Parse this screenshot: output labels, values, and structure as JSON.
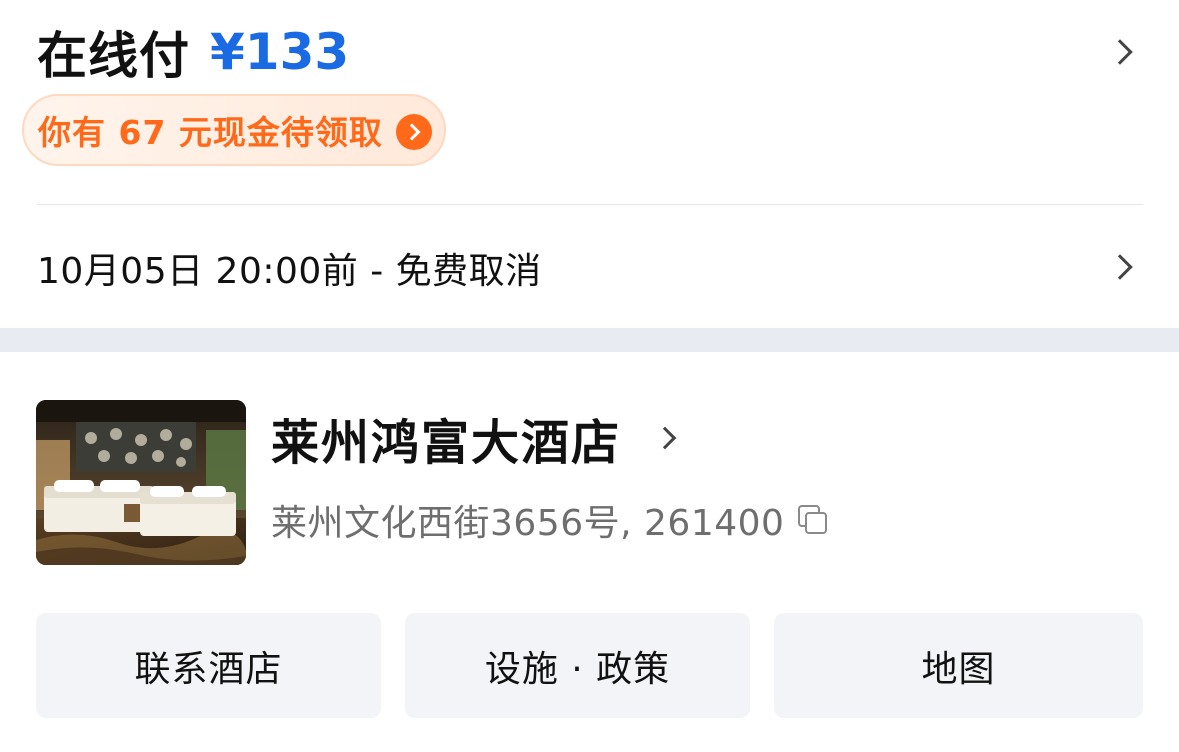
{
  "payment": {
    "label": "在线付",
    "price": "¥133",
    "coupon_text": "你有 67 元现金待领取"
  },
  "cancellation": {
    "text": "10月05日 20:00前 - 免费取消"
  },
  "hotel": {
    "name": "莱州鸿富大酒店",
    "address": "莱州文化西街3656号, 261400"
  },
  "actions": {
    "contact": "联系酒店",
    "facilities": "设施 · 政策",
    "map": "地图"
  },
  "colors": {
    "accent_blue": "#1a6ae3",
    "coupon_orange": "#ff6a1a",
    "band": "#e8ebf2",
    "button_bg": "#f2f4f7"
  },
  "icons": {
    "pay_row": "chevron-right-icon",
    "coupon": "arrow-circle-icon",
    "cancel_row": "chevron-right-icon",
    "hotel_name": "chevron-right-icon",
    "address": "copy-icon"
  }
}
